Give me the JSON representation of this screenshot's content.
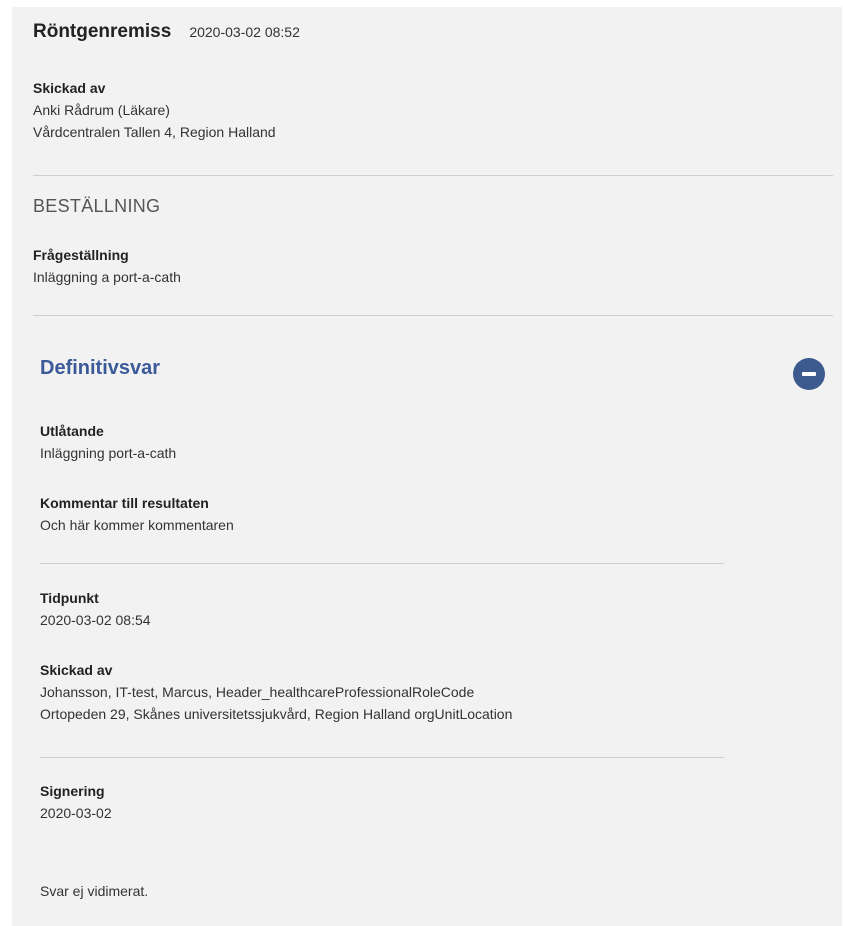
{
  "header": {
    "title": "Röntgenremiss",
    "datetime": "2020-03-02 08:52"
  },
  "sender": {
    "label": "Skickad av",
    "name": "Anki Rådrum (Läkare)",
    "unit": "Vårdcentralen Tallen 4, Region Halland"
  },
  "order": {
    "section_title": "BESTÄLLNING",
    "question_label": "Frågeställning",
    "question_value": "Inläggning a port-a-cath"
  },
  "definitive": {
    "title": "Definitivsvar",
    "collapse_icon": "minus-circle-icon",
    "statement_label": "Utlåtande",
    "statement_value": "Inläggning port-a-cath",
    "comment_label": "Kommentar till resultaten",
    "comment_value": "Och här kommer kommentaren",
    "time_label": "Tidpunkt",
    "time_value": "2020-03-02 08:54",
    "sent_by_label": "Skickad av",
    "sent_by_name": "Johansson, IT-test, Marcus, Header_healthcareProfessionalRoleCode",
    "sent_by_unit": "Ortopeden 29, Skånes universitetssjukvård, Region Halland orgUnitLocation",
    "signing_label": "Signering",
    "signing_value": "2020-03-02",
    "note": "Svar ej vidimerat."
  },
  "colors": {
    "panel_bg": "#f2f2f2",
    "accent": "#3b5a9a",
    "button": "#3d5a8f"
  }
}
